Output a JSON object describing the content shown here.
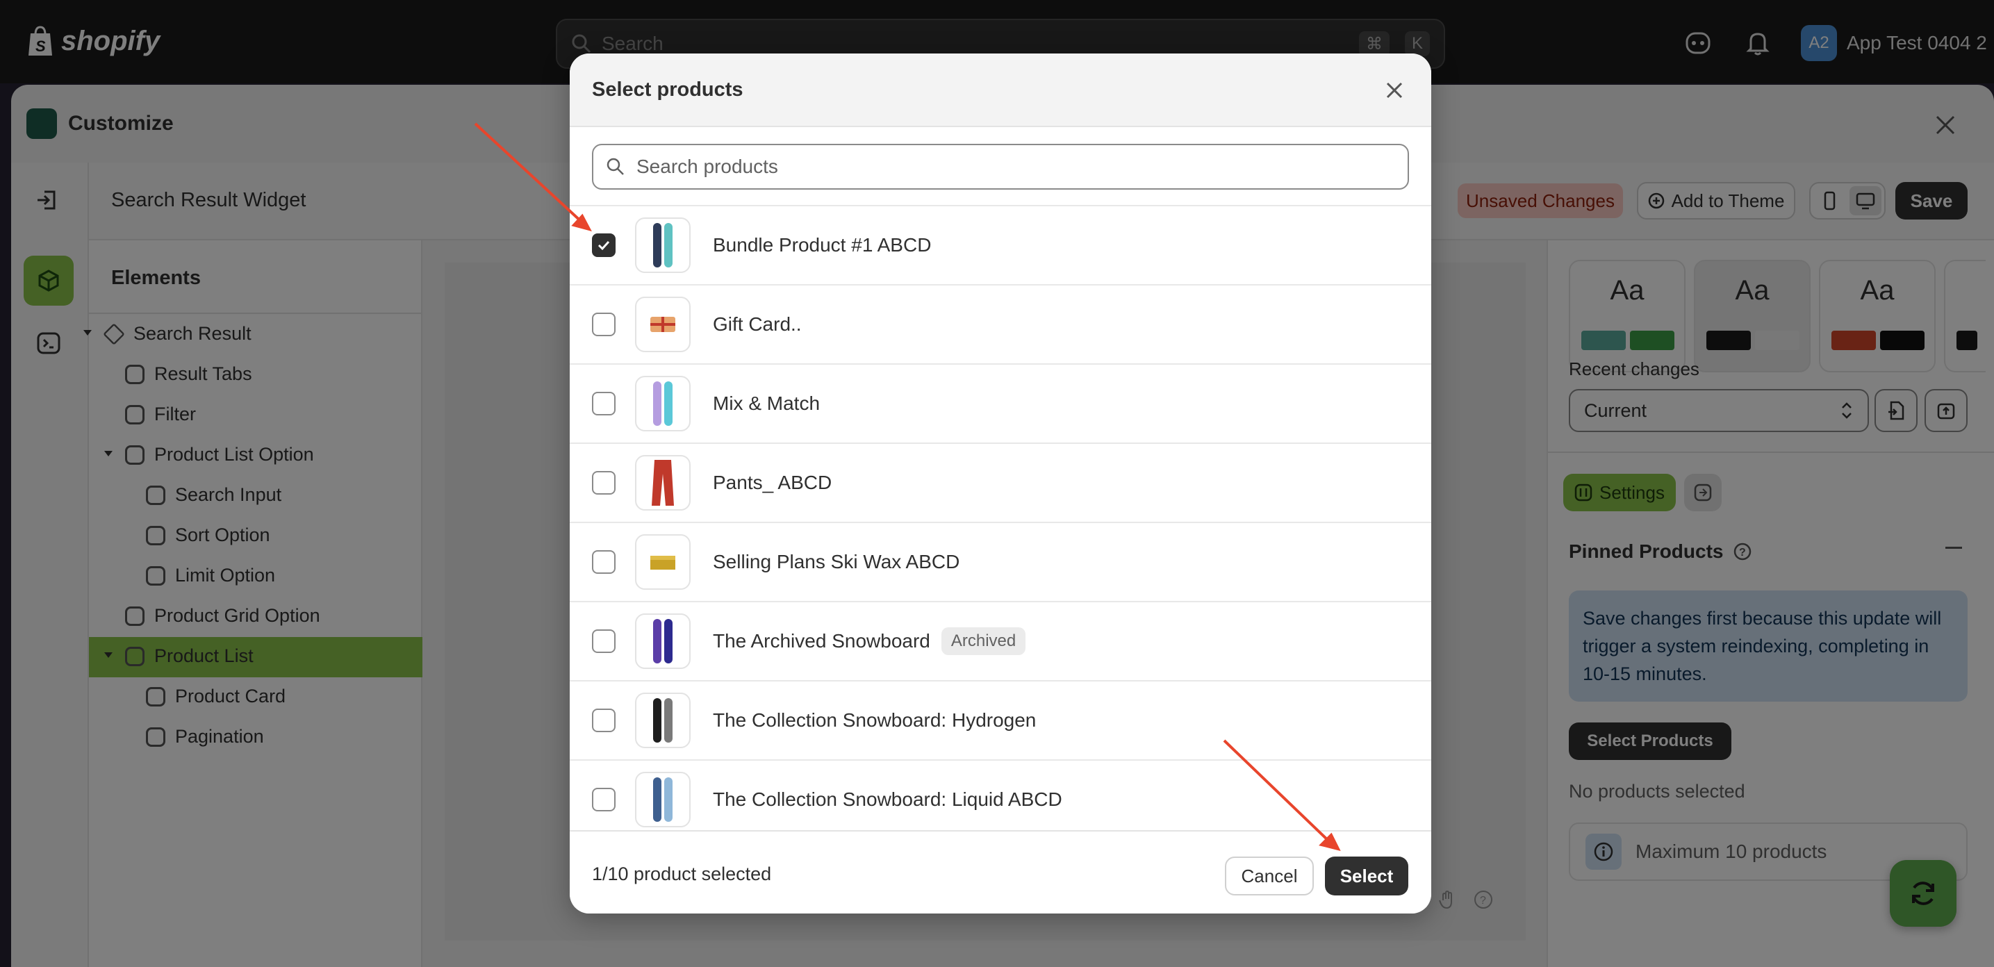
{
  "topbar": {
    "brand": "shopify",
    "search_placeholder": "Search",
    "shortcut_cmd": "⌘",
    "shortcut_key": "K",
    "account_initials": "A2",
    "account_name": "App Test 0404 2"
  },
  "window": {
    "title": "Customize"
  },
  "header": {
    "widget_title": "Search Result Widget",
    "unsaved_label": "Unsaved Changes",
    "add_to_theme_label": "Add to Theme",
    "save_label": "Save"
  },
  "elements": {
    "heading": "Elements",
    "items": [
      {
        "label": "Search Result",
        "level": 0,
        "expanded": true
      },
      {
        "label": "Result Tabs",
        "level": 1
      },
      {
        "label": "Filter",
        "level": 1
      },
      {
        "label": "Product List Option",
        "level": 1,
        "expanded": true
      },
      {
        "label": "Search Input",
        "level": 2
      },
      {
        "label": "Sort Option",
        "level": 2
      },
      {
        "label": "Limit Option",
        "level": 2
      },
      {
        "label": "Product Grid Option",
        "level": 1
      },
      {
        "label": "Product List",
        "level": 1,
        "expanded": true,
        "active": true
      },
      {
        "label": "Product Card",
        "level": 2
      },
      {
        "label": "Pagination",
        "level": 2
      }
    ]
  },
  "right_panel": {
    "theme_swatch_label": "Aa",
    "recent_changes_label": "Recent changes",
    "recent_changes_value": "Current",
    "settings_tab": "Settings",
    "pinned_title": "Pinned Products",
    "info_text": "Save changes first because this update will trigger a system reindexing, completing in 10-15 minutes.",
    "select_products_button": "Select Products",
    "no_products": "No products selected",
    "max_note": "Maximum 10 products"
  },
  "modal": {
    "title": "Select products",
    "search_placeholder": "Search products",
    "products": [
      {
        "name": "Bundle Product #1 ABCD",
        "checked": true,
        "badge": ""
      },
      {
        "name": "Gift Card..",
        "checked": false,
        "badge": ""
      },
      {
        "name": "Mix & Match",
        "checked": false,
        "badge": ""
      },
      {
        "name": "Pants_ ABCD",
        "checked": false,
        "badge": ""
      },
      {
        "name": "Selling Plans Ski Wax ABCD",
        "checked": false,
        "badge": ""
      },
      {
        "name": "The Archived Snowboard",
        "checked": false,
        "badge": "Archived"
      },
      {
        "name": "The Collection Snowboard: Hydrogen",
        "checked": false,
        "badge": ""
      },
      {
        "name": "The Collection Snowboard: Liquid ABCD",
        "checked": false,
        "badge": ""
      }
    ],
    "selection_count": "1/10 product selected",
    "cancel_label": "Cancel",
    "select_label": "Select"
  },
  "colors": {
    "accent_green": "#8bc34a",
    "annotation_arrow": "#e8452c",
    "primary_button": "#303030"
  }
}
